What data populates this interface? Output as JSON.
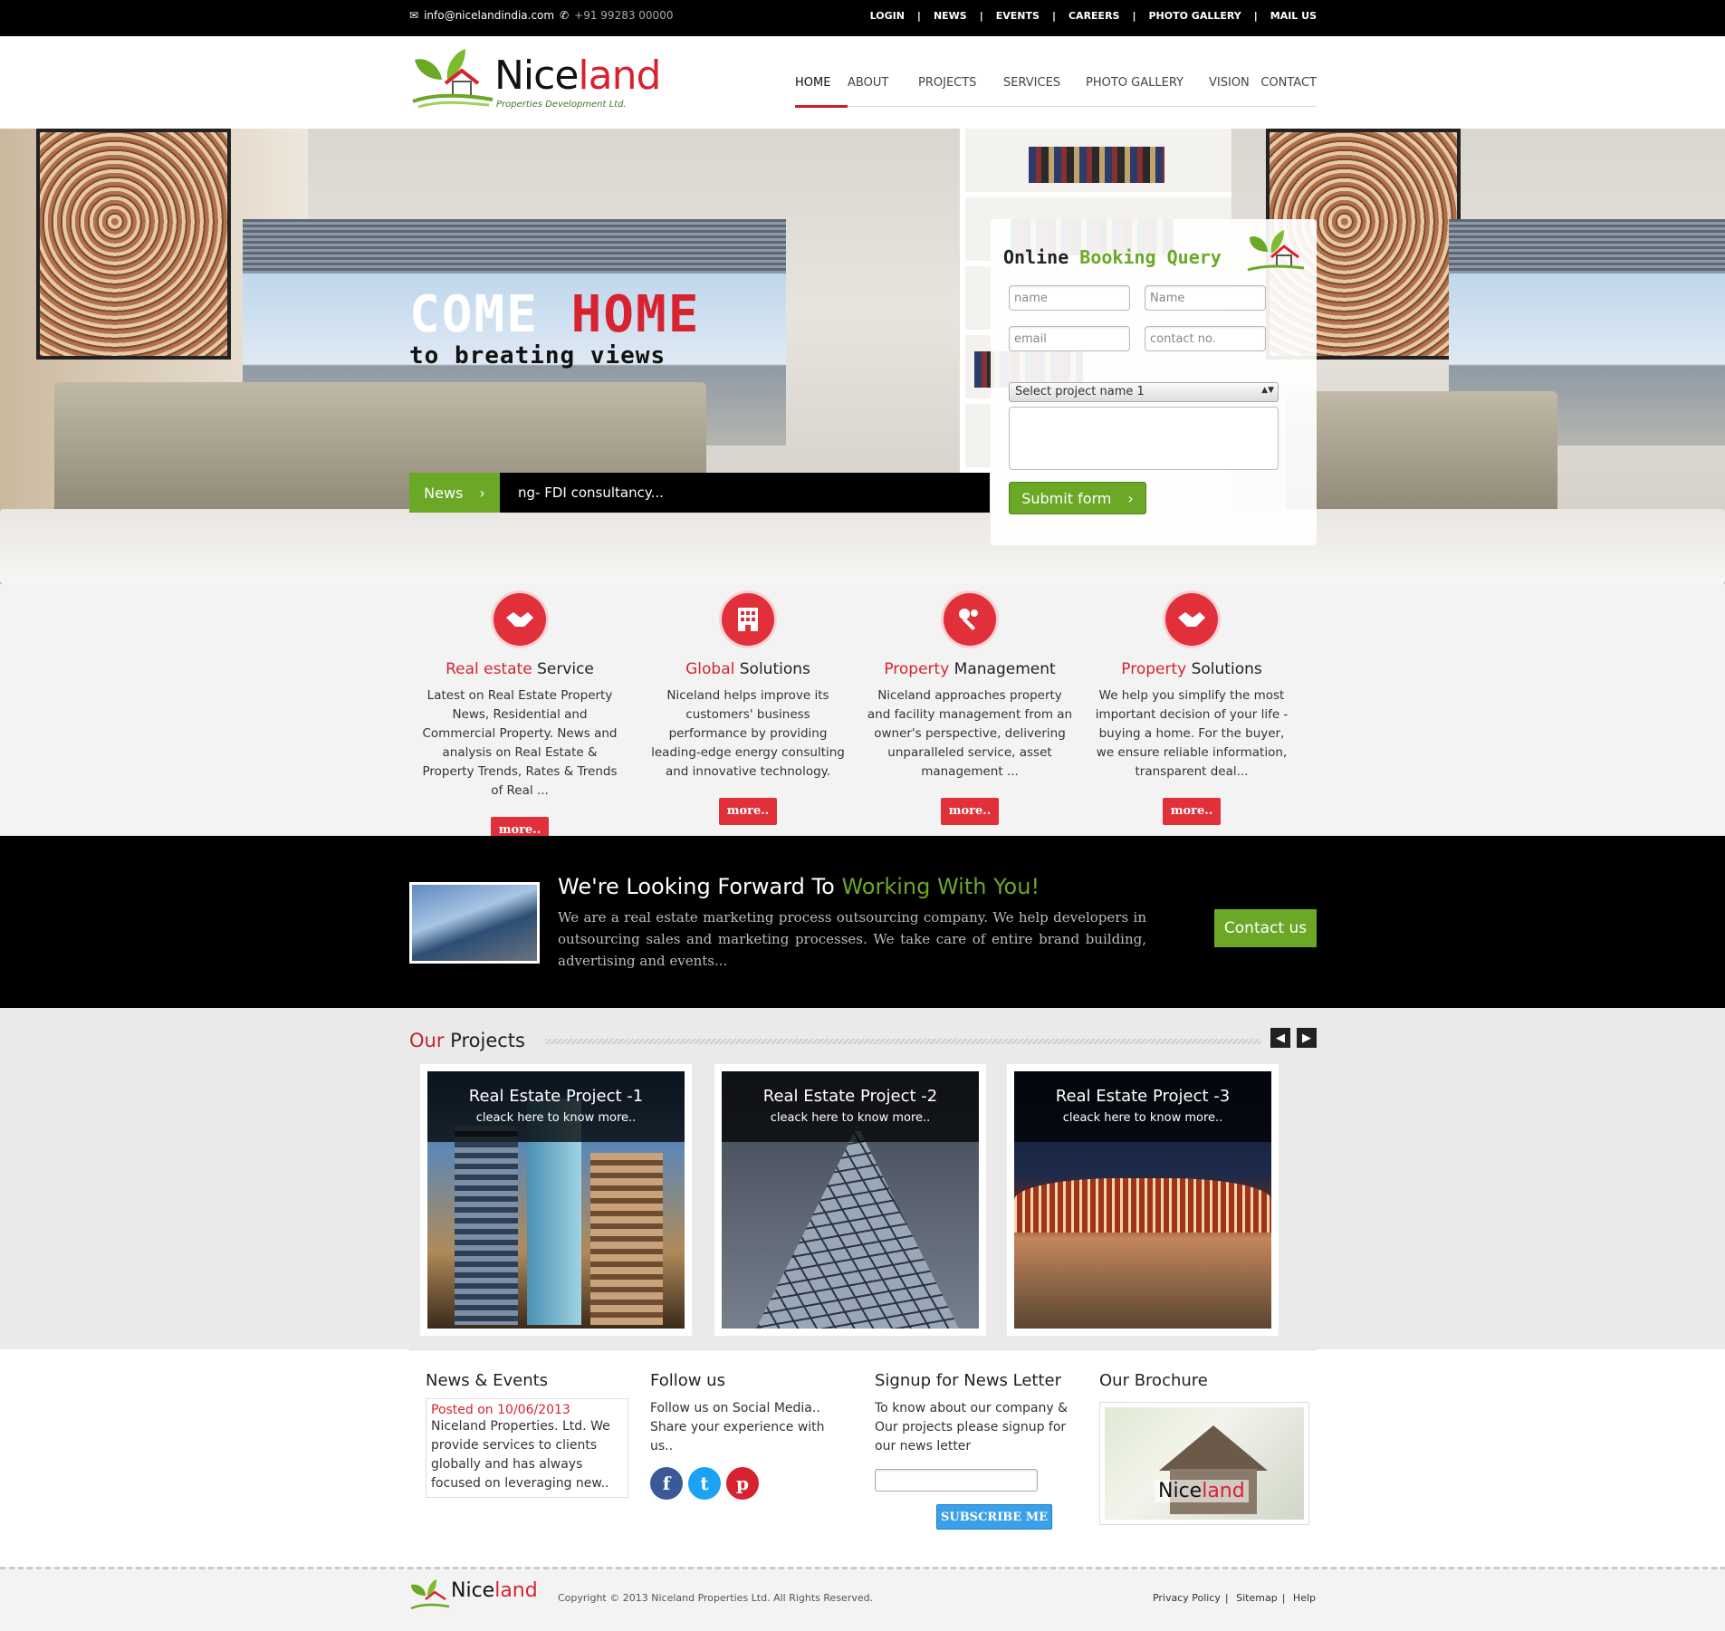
{
  "topbar": {
    "email": "info@nicelandindia.com",
    "phone": "+91 99283 00000",
    "links": [
      "LOGIN",
      "NEWS",
      "EVENTS",
      "CAREERS",
      "PHOTO GALLERY",
      "MAIL US"
    ]
  },
  "logo": {
    "name_a": "Nice",
    "name_b": "land",
    "subtitle": "Properties Development Ltd."
  },
  "nav": [
    "HOME",
    "ABOUT",
    "PROJECTS",
    "SERVICES",
    "PHOTO GALLERY",
    "VISION",
    "CONTACT"
  ],
  "nav_active": "HOME",
  "hero": {
    "title_a": "COME",
    "title_b": "HOME",
    "subtitle": "to breating views",
    "news_tag": "News",
    "news_text": "ng- FDI consultancy..."
  },
  "booking": {
    "title_a": "Online",
    "title_b": "Booking Query",
    "placeholders": {
      "first_name": "name",
      "last_name": "Name",
      "email": "email",
      "contact": "contact no."
    },
    "project_select": "Select project name 1",
    "submit": "Submit form"
  },
  "services": [
    {
      "title_red": "Real estate",
      "title": "Service",
      "text": "Latest on Real Estate Property News, Residential and Commercial Property. News and analysis on Real Estate & Property Trends, Rates & Trends of Real ...",
      "more": "more..",
      "icon": "handshake-icon"
    },
    {
      "title_red": "Global",
      "title": "Solutions",
      "text": "Niceland helps improve its customers' business performance by providing leading-edge energy consulting and innovative technology.",
      "more": "more..",
      "icon": "building-icon"
    },
    {
      "title_red": "Property",
      "title": "Management",
      "text": "Niceland approaches property and facility management from an owner's perspective, delivering unparalleled service, asset management ...",
      "more": "more..",
      "icon": "keys-icon"
    },
    {
      "title_red": "Property",
      "title": "Solutions",
      "text": "We help you simplify the most important decision of your life - buying a home. For the buyer, we ensure reliable information, transparent deal...",
      "more": "more..",
      "icon": "handshake-icon"
    }
  ],
  "band": {
    "title_a": "We're Looking Forward To",
    "title_b": "Working With You!",
    "text": "We are a real estate marketing process outsourcing company. We help developers in outsourcing sales and marketing processes. We take care of entire brand building, advertising and events...",
    "button": "Contact us"
  },
  "projects": {
    "heading_red": "Our",
    "heading": "Projects",
    "items": [
      {
        "title": "Real Estate Project -1",
        "sub": "cleack here to know more.."
      },
      {
        "title": "Real Estate Project -2",
        "sub": "cleack here to know more.."
      },
      {
        "title": "Real Estate Project -3",
        "sub": "cleack here to know more.."
      }
    ]
  },
  "info": {
    "news_title": "News & Events",
    "news_date": "Posted on 10/06/2013",
    "news_text": "Niceland Properties. Ltd. We provide services to clients globally and has always focused on leveraging new..",
    "follow_title": "Follow us",
    "follow_text": "Follow us on Social Media.. Share your experience with us..",
    "newsletter_title": "Signup for News Letter",
    "newsletter_text": "To know about our company & Our projects please signup for our news letter",
    "subscribe": "SUBSCRIBE ME",
    "brochure_title": "Our Brochure"
  },
  "footer": {
    "copyright": "Copyright © 2013 Niceland Properties Ltd. All Rights Reserved.",
    "links": [
      "Privacy Policy",
      "Sitemap",
      "Help"
    ]
  },
  "colors": {
    "red": "#d6232f",
    "green": "#6aa826",
    "black": "#000000"
  }
}
